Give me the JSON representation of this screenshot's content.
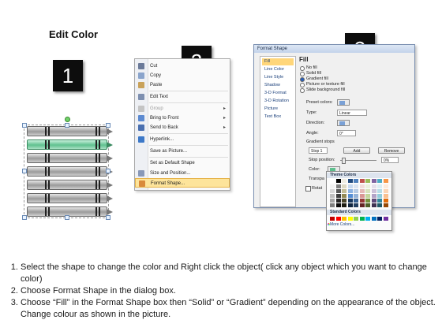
{
  "title": "Edit Color",
  "steps_boxes": [
    "1",
    "2",
    "3"
  ],
  "context_menu": {
    "items": [
      {
        "label": "Cut",
        "icon": "scissors-icon",
        "disabled": false,
        "submenu": false
      },
      {
        "label": "Copy",
        "icon": "copy-icon",
        "disabled": false,
        "submenu": false
      },
      {
        "label": "Paste",
        "icon": "paste-icon",
        "disabled": false,
        "submenu": false
      },
      {
        "label": "Edit Text",
        "icon": "edit-text-icon",
        "disabled": false,
        "submenu": false
      },
      {
        "label": "Group",
        "icon": "group-icon",
        "disabled": true,
        "submenu": true
      },
      {
        "label": "Bring to Front",
        "icon": "bring-front-icon",
        "disabled": false,
        "submenu": true
      },
      {
        "label": "Send to Back",
        "icon": "send-back-icon",
        "disabled": false,
        "submenu": true
      },
      {
        "label": "Hyperlink...",
        "icon": "hyperlink-icon",
        "disabled": false,
        "submenu": false
      },
      {
        "label": "Save as Picture...",
        "icon": "",
        "disabled": false,
        "submenu": false
      },
      {
        "label": "Set as Default Shape",
        "icon": "",
        "disabled": false,
        "submenu": false
      },
      {
        "label": "Size and Position...",
        "icon": "size-icon",
        "disabled": false,
        "submenu": false
      },
      {
        "label": "Format Shape...",
        "icon": "format-shape-icon",
        "disabled": false,
        "submenu": false,
        "highlighted": true
      }
    ]
  },
  "dialog": {
    "title": "Format Shape",
    "nav": [
      "Fill",
      "Line Color",
      "Line Style",
      "Shadow",
      "3-D Format",
      "3-D Rotation",
      "Picture",
      "Text Box"
    ],
    "active_nav": "Fill",
    "heading": "Fill",
    "fill_options": [
      "No fill",
      "Solid fill",
      "Gradient fill",
      "Picture or texture fill",
      "Slide background fill"
    ],
    "selected_fill": "Gradient fill",
    "preset_colors_label": "Preset colors:",
    "type_label": "Type:",
    "type_value": "Linear",
    "direction_label": "Direction:",
    "angle_label": "Angle:",
    "angle_value": "0°",
    "gradient_stops_label": "Gradient stops",
    "stop_value": "Stop 1",
    "add_label": "Add",
    "remove_label": "Remove",
    "stop_position_label": "Stop position:",
    "stop_position_value": "0%",
    "color_label": "Color:",
    "transparency_label": "Transpa",
    "rotate_label": "Rotat"
  },
  "color_picker": {
    "theme_label": "Theme Colors",
    "standard_label": "Standard Colors",
    "more_label": "More Colors...",
    "theme_top": [
      "#ffffff",
      "#000000",
      "#eeece1",
      "#1f497d",
      "#4f81bd",
      "#c0504d",
      "#9bbb59",
      "#8064a2",
      "#4bacc6",
      "#f79646"
    ],
    "theme_shades": [
      [
        "#f2f2f2",
        "#7f7f7f",
        "#ddd9c3",
        "#c6d9f0",
        "#dbe5f1",
        "#f2dcdb",
        "#ebf1dd",
        "#e5e0ec",
        "#dbeef3",
        "#fdeada"
      ],
      [
        "#d8d8d8",
        "#595959",
        "#c4bd97",
        "#8db3e2",
        "#b8cce4",
        "#e5b9b7",
        "#d7e3bc",
        "#ccc1d9",
        "#b7dde8",
        "#fbd5b5"
      ],
      [
        "#bfbfbf",
        "#3f3f3f",
        "#938953",
        "#548dd4",
        "#95b3d7",
        "#d99694",
        "#c3d69b",
        "#b2a2c7",
        "#92cddc",
        "#fac08f"
      ],
      [
        "#a5a5a5",
        "#262626",
        "#494429",
        "#17365d",
        "#366092",
        "#953734",
        "#76923c",
        "#5f497a",
        "#31859b",
        "#e36c09"
      ],
      [
        "#7f7f7f",
        "#0c0c0c",
        "#1d1b10",
        "#0f243e",
        "#244061",
        "#632423",
        "#4f6128",
        "#3f3151",
        "#205867",
        "#974806"
      ]
    ],
    "standard": [
      "#c00000",
      "#ff0000",
      "#ffc000",
      "#ffff00",
      "#92d050",
      "#00b050",
      "#00b0f0",
      "#0070c0",
      "#002060",
      "#7030a0"
    ]
  },
  "instructions": [
    "Select the shape to change the color and Right click the object( click any object which you want to change color)",
    "Choose Format Shape in the dialog box.",
    "Choose “Fill” in the Format Shape box then “Solid” or “Gradient” depending on the appearance of the object. Change colour as shown in the picture."
  ],
  "colors": {
    "accent_green": "#5fc18f",
    "menu_highlight": "#fde49b",
    "nav_highlight": "#ffd67a"
  }
}
